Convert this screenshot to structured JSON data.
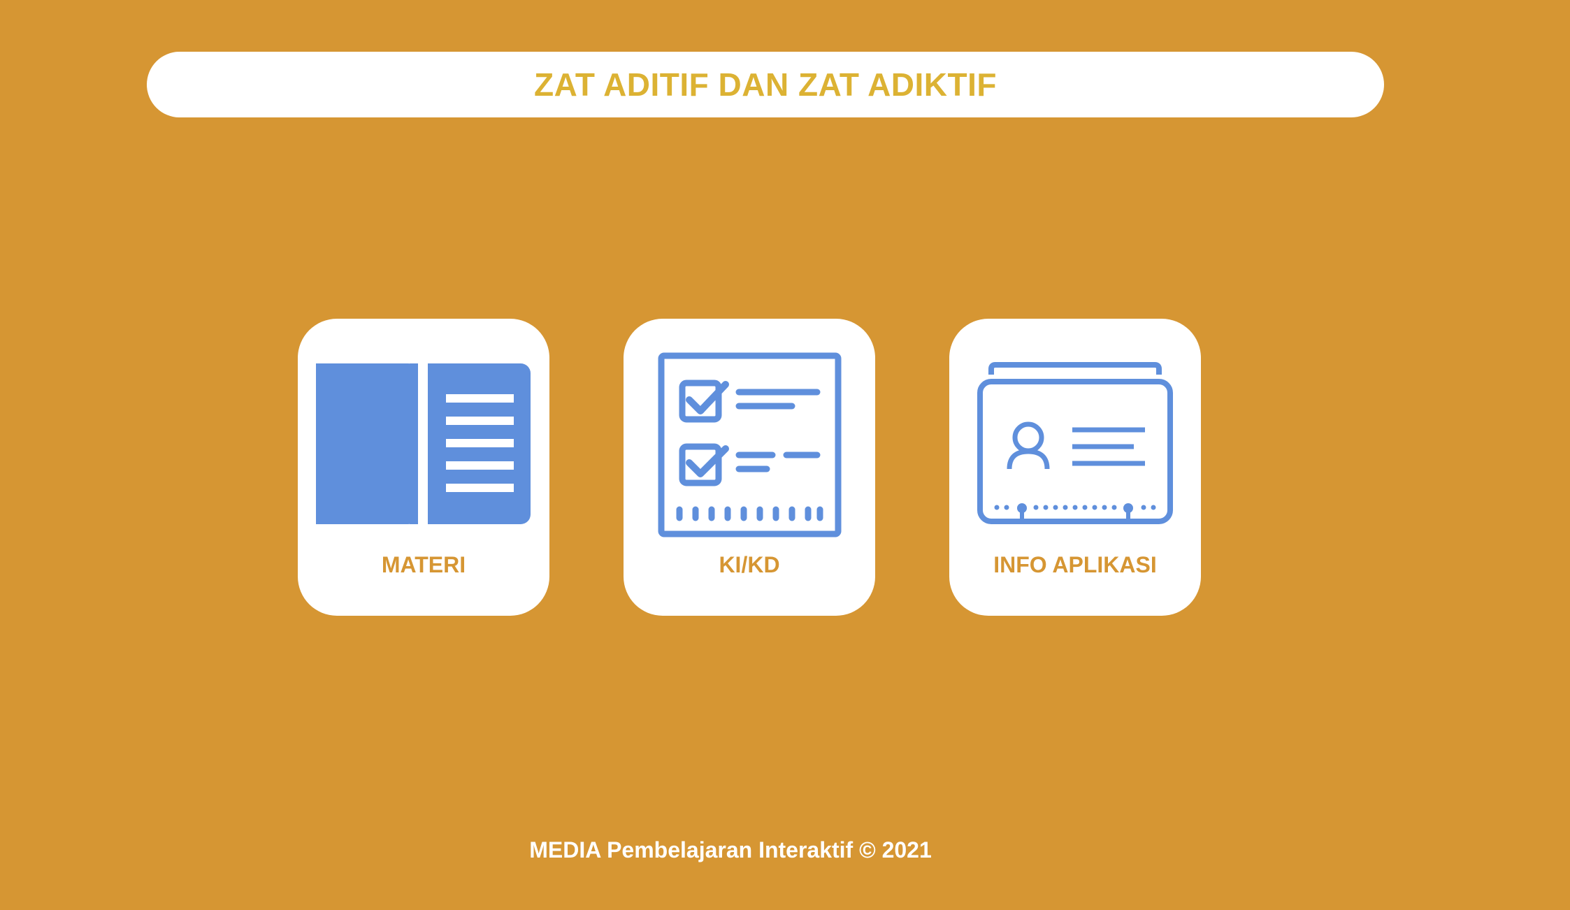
{
  "header": {
    "title": "ZAT ADITIF DAN ZAT ADIKTIF"
  },
  "menu": [
    {
      "label": "MATERI",
      "icon": "book-icon"
    },
    {
      "label": "KI/KD",
      "icon": "checklist-icon"
    },
    {
      "label": "INFO APLIKASI",
      "icon": "id-card-icon"
    }
  ],
  "footer": {
    "text": "MEDIA Pembelajaran Interaktif © 2021"
  },
  "colors": {
    "background": "#D69633",
    "title_text": "#DCB233",
    "icon_blue": "#5F8FDC",
    "card": "#FFFFFF",
    "label_text": "#D69633"
  }
}
